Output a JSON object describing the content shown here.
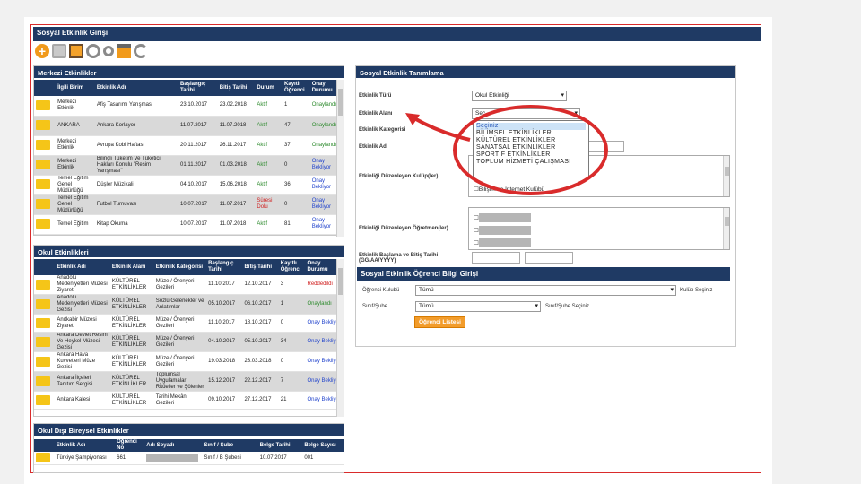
{
  "title": "Sosyal Etkinlik Girişi",
  "merkezi": {
    "header": "Merkezi Etkinlikler",
    "columns": [
      "İlgili Birim",
      "Etkinlik Adı",
      "Başlangıç Tarihi",
      "Bitiş Tarihi",
      "Durum",
      "Kayıtlı Öğrenci",
      "Onay Durumu"
    ],
    "rows": [
      [
        "Merkezi Etkinlik",
        "Afiş Tasarımı Yarışması",
        "23.10.2017",
        "23.02.2018",
        "Aktif",
        "1",
        "Onaylandı"
      ],
      [
        "ANKARA",
        "Ankara Korlayor",
        "11.07.2017",
        "11.07.2018",
        "Aktif",
        "47",
        "Onaylandı"
      ],
      [
        "Merkezi Etkinlik",
        "Avrupa Kobi Haftası",
        "20.11.2017",
        "26.11.2017",
        "Aktif",
        "37",
        "Onaylandı"
      ],
      [
        "Merkezi Etkinlik",
        "Bilinçli Tüketim Ve Tüketici Hakları Konulu \"Resim Yarışması\"",
        "01.11.2017",
        "01.03.2018",
        "Aktif",
        "0",
        "Onay Bekliyor"
      ],
      [
        "Temel Eğitim Genel Müdürlüğü",
        "Düşler Müzikali",
        "04.10.2017",
        "15.06.2018",
        "Aktif",
        "36",
        "Onay Bekliyor"
      ],
      [
        "Temel Eğitim Genel Müdürlüğü",
        "Futbol Turnuvası",
        "10.07.2017",
        "11.07.2017",
        "Süresi Dolu",
        "0",
        "Onay Bekliyor"
      ],
      [
        "Temel Eğitim",
        "Kitap Okuma",
        "10.07.2017",
        "11.07.2018",
        "Aktif",
        "81",
        "Onay Bekliyor"
      ]
    ]
  },
  "okul": {
    "header": "Okul Etkinlikleri",
    "columns": [
      "Etkinlik Adı",
      "Etkinlik Alanı",
      "Etkinlik Kategorisi",
      "Başlangıç Tarihi",
      "Bitiş Tarihi",
      "Kayıtlı Öğrenci",
      "Onay Durumu"
    ],
    "rows": [
      [
        "Anadolu Medeniyetleri Müzesi Ziyareti",
        "KÜLTÜREL ETKİNLİKLER",
        "Müze / Örenyeri Gezileri",
        "11.10.2017",
        "12.10.2017",
        "3",
        "Reddedildi"
      ],
      [
        "Anadolu Medeniyetleri Müzesi Gezisi",
        "KÜLTÜREL ETKİNLİKLER",
        "Sözlü Gelenekler ve Anlatımlar",
        "05.10.2017",
        "06.10.2017",
        "1",
        "Onaylandı"
      ],
      [
        "Anıtkabir Müzesi Ziyareti",
        "KÜLTÜREL ETKİNLİKLER",
        "Müze / Örenyeri Gezileri",
        "11.10.2017",
        "18.10.2017",
        "0",
        "Onay Bekliyor"
      ],
      [
        "Ankara Devlet Resim Ve Heykel Müzesi Gezisi",
        "KÜLTÜREL ETKİNLİKLER",
        "Müze / Örenyeri Gezileri",
        "04.10.2017",
        "05.10.2017",
        "34",
        "Onay Bekliyor"
      ],
      [
        "Ankara Hava Kuvvetleri Müze Gezisi",
        "KÜLTÜREL ETKİNLİKLER",
        "Müze / Örenyeri Gezileri",
        "19.03.2018",
        "23.03.2018",
        "0",
        "Onay Bekliyor"
      ],
      [
        "Ankara İlçeleri Tanıtım Sergisi",
        "KÜLTÜREL ETKİNLİKLER",
        "Toplumsal Uygulamalar Ritüeller ve Şölenler",
        "15.12.2017",
        "22.12.2017",
        "7",
        "Onay Bekliyor"
      ],
      [
        "Ankara Kalesi",
        "KÜLTÜREL ETKİNLİKLER",
        "Tarihi Mekân Gezileri",
        "09.10.2017",
        "27.12.2017",
        "21",
        "Onay Bekliyor"
      ]
    ]
  },
  "bireysel": {
    "header": "Okul Dışı Bireysel Etkinlikler",
    "columns": [
      "Etkinlik Adı",
      "Öğrenci No",
      "Adı Soyadı",
      "Sınıf / Şube",
      "Belge Tarihi",
      "Belge Sayısı"
    ],
    "rows": [
      [
        "Türkiye Şampiyonası",
        "661",
        "",
        "Sınıf / B Şubesi",
        "10.07.2017",
        "001"
      ]
    ]
  },
  "form": {
    "header": "Sosyal Etkinlik Tanımlama",
    "etkinlik_turu_label": "Etkinlik Türü",
    "etkinlik_turu_value": "Okul Etkinliği",
    "etkinlik_alani_label": "Etkinlik Alanı",
    "etkinlik_alani_value": "Seç",
    "etkinlik_kategorisi_label": "Etkinlik Kategorisi",
    "etkinlik_adi_label": "Etkinlik Adı",
    "kulup_label": "Etkinliği Düzenleyen Kulüp(ler)",
    "kulup_item": "Bilişim ve İnternet Kulübü",
    "ogretmen_label": "Etkinliği Düzenleyen Öğretmen(ler)",
    "tarih_label": "Etkinlik Başlama ve Bitiş Tarihi (GG/AA/YYYY)",
    "dropdown_options": [
      "Seçiniz",
      "BİLİMSEL ETKİNLİKLER",
      "KÜLTÜREL ETKİNLİKLER",
      "SANATSAL ETKİNLİKLER",
      "SPORTİF ETKİNLİKLER",
      "TOPLUM HİZMETİ ÇALIŞMASI"
    ]
  },
  "ogrenci": {
    "header": "Sosyal Etkinlik Öğrenci Bilgi Girişi",
    "kulup_label": "Öğrenci Kulubü",
    "kulup_value": "Tümü",
    "kulup_hint": "Kulüp Seçiniz",
    "sinif_label": "Sınıf/Şube",
    "sinif_value": "Tümü",
    "sinif_hint": "Sınıf/Şube Seçiniz",
    "button": "Öğrenci Listesi"
  },
  "colors": {
    "header": "#1f3a64",
    "accent": "#f29c2b",
    "highlight": "#d92b2b"
  }
}
